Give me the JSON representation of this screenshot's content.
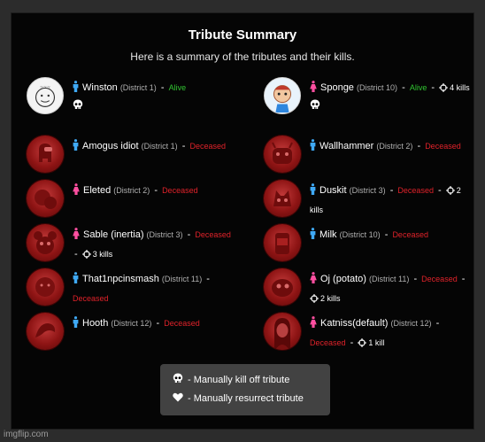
{
  "header": {
    "title": "Tribute Summary",
    "subtitle": "Here is a summary of the tributes and their kills."
  },
  "colors": {
    "male": "#3fa9f5",
    "female": "#ff4fa0",
    "deceased": "#e0222a",
    "alive": "#31c531"
  },
  "separator": "-",
  "tributes": [
    {
      "name": "Winston",
      "district": "(District 1)",
      "status": "Alive",
      "gender": "male",
      "kills": "",
      "alive": true
    },
    {
      "name": "Sponge",
      "district": "(District 10)",
      "status": "Alive",
      "gender": "female",
      "kills": "4 kills",
      "alive": true
    },
    {
      "name": "Amogus idiot",
      "district": "(District 1)",
      "status": "Deceased",
      "gender": "male",
      "kills": "",
      "alive": false
    },
    {
      "name": "Wallhammer",
      "district": "(District 2)",
      "status": "Deceased",
      "gender": "male",
      "kills": "",
      "alive": false
    },
    {
      "name": "Eleted",
      "district": "(District 2)",
      "status": "Deceased",
      "gender": "female",
      "kills": "",
      "alive": false
    },
    {
      "name": "Duskit",
      "district": "(District 3)",
      "status": "Deceased",
      "gender": "male",
      "kills": "2 kills",
      "alive": false
    },
    {
      "name": "Sable (inertia)",
      "district": "(District 3)",
      "status": "Deceased",
      "gender": "female",
      "kills": "3 kills",
      "alive": false
    },
    {
      "name": "Milk",
      "district": "(District 10)",
      "status": "Deceased",
      "gender": "male",
      "kills": "",
      "alive": false
    },
    {
      "name": "That1npcinsmash",
      "district": "(District 11)",
      "status": "Deceased",
      "gender": "male",
      "kills": "",
      "alive": false
    },
    {
      "name": "Oj (potato)",
      "district": "(District 11)",
      "status": "Deceased",
      "gender": "female",
      "kills": "2 kills",
      "alive": false
    },
    {
      "name": "Hooth",
      "district": "(District 12)",
      "status": "Deceased",
      "gender": "male",
      "kills": "",
      "alive": false
    },
    {
      "name": "Katniss(default)",
      "district": "(District 12)",
      "status": "Deceased",
      "gender": "female",
      "kills": "1 kill",
      "alive": false
    }
  ],
  "legend": {
    "kill_label": "- Manually kill off tribute",
    "resurrect_label": "- Manually resurrect tribute",
    "kill_icon": "skull-icon",
    "resurrect_icon": "heart-icon"
  },
  "watermark": "imgflip.com"
}
